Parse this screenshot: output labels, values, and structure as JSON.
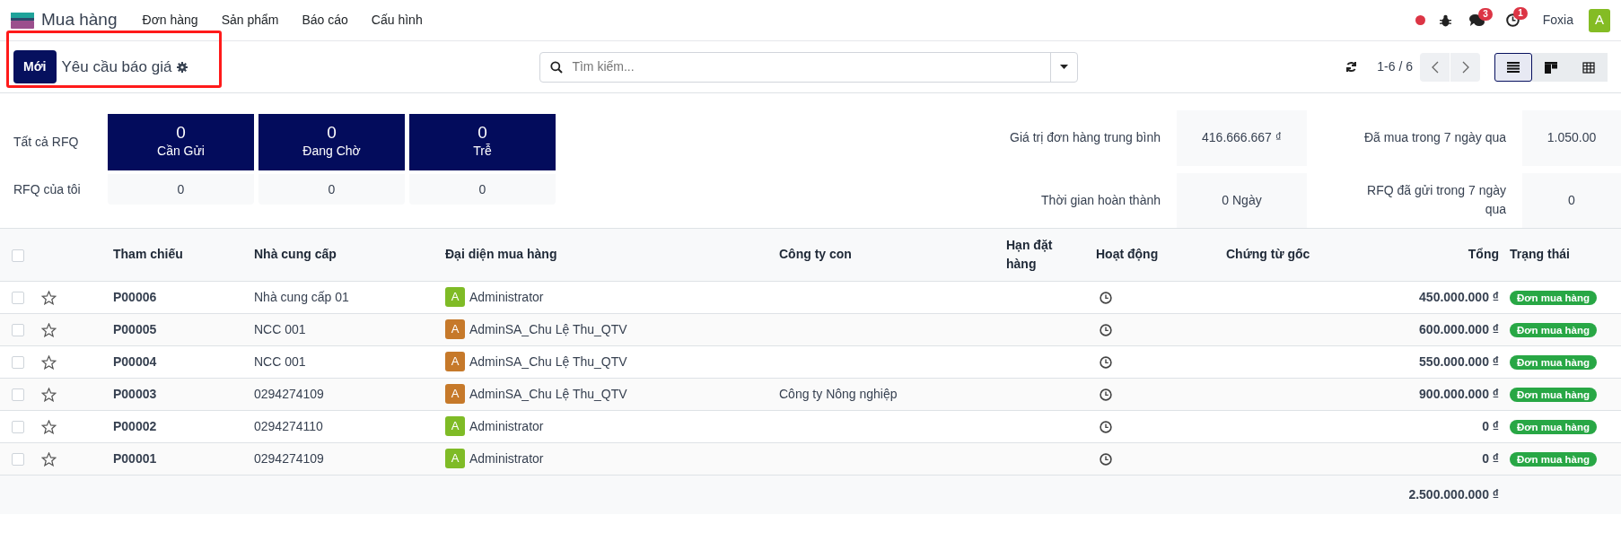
{
  "app": {
    "name": "Mua hàng",
    "menu": [
      "Đơn hàng",
      "Sản phẩm",
      "Báo cáo",
      "Cấu hình"
    ]
  },
  "systray": {
    "chat_count": "3",
    "activity_count": "1",
    "company": "Foxia",
    "avatar": "A"
  },
  "control_panel": {
    "new_button": "Mới",
    "title": "Yêu cầu báo giá",
    "search": {
      "placeholder": "Tìm kiếm..."
    },
    "pager": "1-6 / 6",
    "views": [
      {
        "kind": "list",
        "selected": true
      },
      {
        "kind": "kanban",
        "selected": false
      },
      {
        "kind": "pivot",
        "selected": false
      }
    ]
  },
  "dashboard": {
    "rows": [
      {
        "label": "Tất cả RFQ",
        "tiles": [
          {
            "value": "0",
            "label": "Cần Gửi"
          },
          {
            "value": "0",
            "label": "Đang Chờ"
          },
          {
            "value": "0",
            "label": "Trễ"
          }
        ]
      },
      {
        "label": "RFQ của tôi",
        "tiles": [
          {
            "value": "0"
          },
          {
            "value": "0"
          },
          {
            "value": "0"
          }
        ]
      }
    ],
    "stats": [
      {
        "label": "Giá trị đơn hàng trung bình",
        "value": "416.666.667 ₫"
      },
      {
        "label": "Đã mua trong 7 ngày qua",
        "value": "1.050.00"
      },
      {
        "label": "Thời gian hoàn thành",
        "value": "0 Ngày"
      },
      {
        "label": "RFQ đã gửi trong 7 ngày qua",
        "value": "0"
      }
    ]
  },
  "table": {
    "select_all": {
      "checked": false
    },
    "columns": [
      "Tham chiếu",
      "Nhà cung cấp",
      "Đại diện mua hàng",
      "Công ty con",
      "Hạn đặt hàng",
      "Hoạt động",
      "Chứng từ gốc",
      "Tổng",
      "Trạng thái"
    ],
    "rows": [
      {
        "checked": false,
        "starred": false,
        "reference": "P00006",
        "supplier": "Nhà cung cấp 01",
        "rep": {
          "initial": "A",
          "name": "Administrator",
          "color": "#7fbb26"
        },
        "company": "",
        "total": "450.000.000 ₫",
        "status": "Đơn mua hàng"
      },
      {
        "checked": false,
        "starred": false,
        "reference": "P00005",
        "supplier": "NCC 001",
        "rep": {
          "initial": "A",
          "name": "AdminSA_Chu Lệ Thu_QTV",
          "color": "#c6792a"
        },
        "company": "",
        "total": "600.000.000 ₫",
        "status": "Đơn mua hàng"
      },
      {
        "checked": false,
        "starred": false,
        "reference": "P00004",
        "supplier": "NCC 001",
        "rep": {
          "initial": "A",
          "name": "AdminSA_Chu Lệ Thu_QTV",
          "color": "#c6792a"
        },
        "company": "",
        "total": "550.000.000 ₫",
        "status": "Đơn mua hàng"
      },
      {
        "checked": false,
        "starred": false,
        "reference": "P00003",
        "supplier": "0294274109",
        "rep": {
          "initial": "A",
          "name": "AdminSA_Chu Lệ Thu_QTV",
          "color": "#c6792a"
        },
        "company": "Công ty Nông nghiệp",
        "total": "900.000.000 ₫",
        "status": "Đơn mua hàng"
      },
      {
        "checked": false,
        "starred": false,
        "reference": "P00002",
        "supplier": "0294274110",
        "rep": {
          "initial": "A",
          "name": "Administrator",
          "color": "#7fbb26"
        },
        "company": "",
        "total": "0 ₫",
        "status": "Đơn mua hàng"
      },
      {
        "checked": false,
        "starred": false,
        "reference": "P00001",
        "supplier": "0294274109",
        "rep": {
          "initial": "A",
          "name": "Administrator",
          "color": "#7fbb26"
        },
        "company": "",
        "total": "0 ₫",
        "status": "Đơn mua hàng"
      }
    ],
    "footer_total": "2.500.000.000 ₫"
  }
}
